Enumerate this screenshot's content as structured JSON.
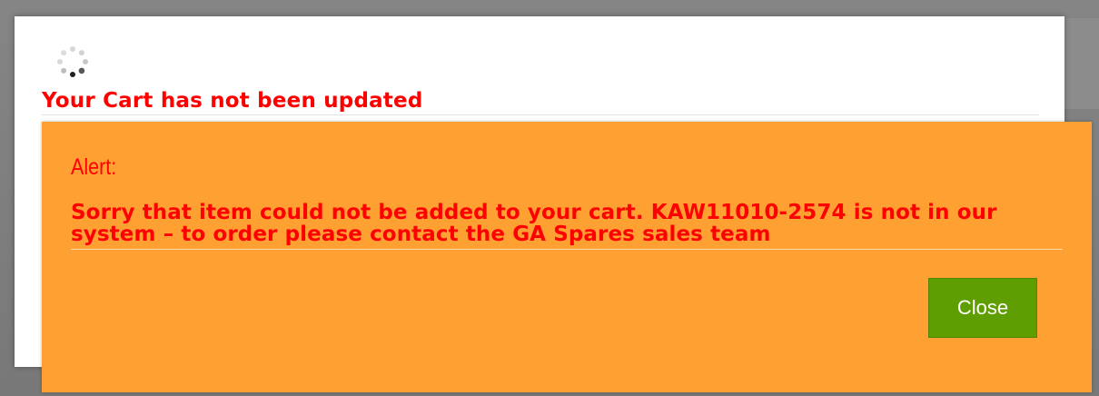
{
  "background_modal": {
    "title": "Your Cart has not been updated"
  },
  "alert": {
    "title": "Alert:",
    "message": "Sorry that item could not be added to your cart.  KAW11010-2574 is not in our system – to order please contact the GA Spares sales team",
    "close_label": "Close"
  },
  "colors": {
    "alert_background": "#ffa033",
    "error_text": "#ff0000",
    "close_button": "#5f9e00"
  },
  "icons": {
    "spinner": "loading-spinner-icon"
  }
}
